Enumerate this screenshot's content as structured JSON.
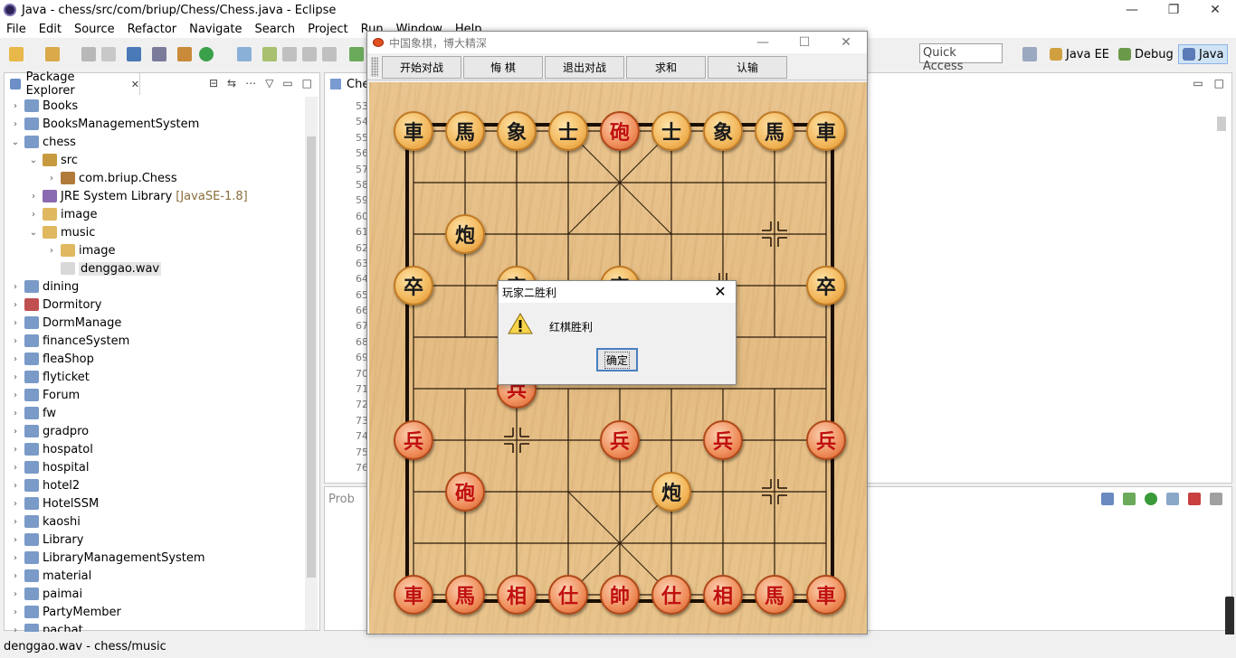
{
  "window": {
    "title": "Java - chess/src/com/briup/Chess/Chess.java - Eclipse",
    "min": "—",
    "restore": "❐",
    "close": "✕"
  },
  "menu": [
    "File",
    "Edit",
    "Source",
    "Refactor",
    "Navigate",
    "Search",
    "Project",
    "Run",
    "Window",
    "Help"
  ],
  "toolbar": {
    "quick_access": "Quick Access",
    "perspectives": [
      "Java EE",
      "Debug",
      "Java"
    ]
  },
  "package_explorer": {
    "tab_label": "Package Explorer",
    "tab_close": "✕",
    "items": [
      {
        "label": "Books",
        "arrow": "›",
        "icon": "project-icon",
        "indent": 0
      },
      {
        "label": "BooksManagementSystem",
        "arrow": "›",
        "icon": "project-icon",
        "indent": 0
      },
      {
        "label": "chess",
        "arrow": "⌄",
        "icon": "project-icon",
        "indent": 0
      },
      {
        "label": "src",
        "arrow": "⌄",
        "icon": "source-folder-icon",
        "indent": 1
      },
      {
        "label": "com.briup.Chess",
        "arrow": "›",
        "icon": "package-icon",
        "indent": 2
      },
      {
        "label": "JRE System Library",
        "decoration": "[JavaSE-1.8]",
        "arrow": "›",
        "icon": "library-icon",
        "indent": 1
      },
      {
        "label": "image",
        "arrow": "›",
        "icon": "folder-icon",
        "indent": 1
      },
      {
        "label": "music",
        "arrow": "⌄",
        "icon": "folder-icon",
        "indent": 1
      },
      {
        "label": "image",
        "arrow": "›",
        "icon": "folder-icon",
        "indent": 2
      },
      {
        "label": "denggao.wav",
        "arrow": "",
        "icon": "file-icon",
        "indent": 2,
        "selected": true
      },
      {
        "label": "dining",
        "arrow": "›",
        "icon": "project-icon",
        "indent": 0
      },
      {
        "label": "Dormitory",
        "arrow": "›",
        "icon": "project-error-icon",
        "indent": 0
      },
      {
        "label": "DormManage",
        "arrow": "›",
        "icon": "project-icon",
        "indent": 0
      },
      {
        "label": "financeSystem",
        "arrow": "›",
        "icon": "project-icon",
        "indent": 0
      },
      {
        "label": "fleaShop",
        "arrow": "›",
        "icon": "project-icon",
        "indent": 0
      },
      {
        "label": "flyticket",
        "arrow": "›",
        "icon": "project-icon",
        "indent": 0
      },
      {
        "label": "Forum",
        "arrow": "›",
        "icon": "project-icon",
        "indent": 0
      },
      {
        "label": "fw",
        "arrow": "›",
        "icon": "project-icon",
        "indent": 0
      },
      {
        "label": "gradpro",
        "arrow": "›",
        "icon": "project-icon",
        "indent": 0
      },
      {
        "label": "hospatol",
        "arrow": "›",
        "icon": "project-icon",
        "indent": 0
      },
      {
        "label": "hospital",
        "arrow": "›",
        "icon": "project-icon",
        "indent": 0
      },
      {
        "label": "hotel2",
        "arrow": "›",
        "icon": "project-icon",
        "indent": 0
      },
      {
        "label": "HotelSSM",
        "arrow": "›",
        "icon": "project-icon",
        "indent": 0
      },
      {
        "label": "kaoshi",
        "arrow": "›",
        "icon": "project-icon",
        "indent": 0
      },
      {
        "label": "Library",
        "arrow": "›",
        "icon": "project-icon",
        "indent": 0
      },
      {
        "label": "LibraryManagementSystem",
        "arrow": "›",
        "icon": "project-icon",
        "indent": 0
      },
      {
        "label": "material",
        "arrow": "›",
        "icon": "project-icon",
        "indent": 0
      },
      {
        "label": "paimai",
        "arrow": "›",
        "icon": "project-icon",
        "indent": 0
      },
      {
        "label": "PartyMember",
        "arrow": "›",
        "icon": "project-icon",
        "indent": 0
      },
      {
        "label": "pachat",
        "arrow": "›",
        "icon": "project-icon",
        "indent": 0
      }
    ]
  },
  "editor": {
    "tab_label": "Che",
    "line_numbers": [
      "53",
      "54",
      "55",
      "56",
      "57",
      "58",
      "59",
      "60",
      "61",
      "62",
      "63",
      "64",
      "65",
      "66",
      "67",
      "68",
      "69",
      "70",
      "71",
      "72",
      "73",
      "74",
      "75",
      "76"
    ]
  },
  "bottom_panel": {
    "tab_label": "Prob"
  },
  "status": {
    "text": "denggao.wav - chess/music"
  },
  "chess": {
    "title": "中国象棋，博大精深",
    "buttons": [
      "开始对战",
      "悔  棋",
      "退出对战",
      "求和",
      "认输"
    ],
    "pieces": [
      {
        "char": "車",
        "side": "black",
        "col": 0,
        "row": 0
      },
      {
        "char": "馬",
        "side": "black",
        "col": 1,
        "row": 0
      },
      {
        "char": "象",
        "side": "black",
        "col": 2,
        "row": 0
      },
      {
        "char": "士",
        "side": "black",
        "col": 3,
        "row": 0
      },
      {
        "char": "砲",
        "side": "red",
        "col": 4,
        "row": 0
      },
      {
        "char": "士",
        "side": "black",
        "col": 5,
        "row": 0
      },
      {
        "char": "象",
        "side": "black",
        "col": 6,
        "row": 0
      },
      {
        "char": "馬",
        "side": "black",
        "col": 7,
        "row": 0
      },
      {
        "char": "車",
        "side": "black",
        "col": 8,
        "row": 0
      },
      {
        "char": "炮",
        "side": "black",
        "col": 1,
        "row": 2
      },
      {
        "char": "卒",
        "side": "black",
        "col": 0,
        "row": 3
      },
      {
        "char": "卒",
        "side": "black",
        "col": 2,
        "row": 3
      },
      {
        "char": "卒",
        "side": "black",
        "col": 4,
        "row": 3
      },
      {
        "char": "卒",
        "side": "black",
        "col": 8,
        "row": 3
      },
      {
        "char": "兵",
        "side": "red",
        "col": 2,
        "row": 5
      },
      {
        "char": "兵",
        "side": "red",
        "col": 0,
        "row": 6
      },
      {
        "char": "兵",
        "side": "red",
        "col": 4,
        "row": 6
      },
      {
        "char": "兵",
        "side": "red",
        "col": 6,
        "row": 6
      },
      {
        "char": "兵",
        "side": "red",
        "col": 8,
        "row": 6
      },
      {
        "char": "砲",
        "side": "red",
        "col": 1,
        "row": 7
      },
      {
        "char": "炮",
        "side": "black",
        "col": 5,
        "row": 7
      },
      {
        "char": "車",
        "side": "red",
        "col": 0,
        "row": 9
      },
      {
        "char": "馬",
        "side": "red",
        "col": 1,
        "row": 9
      },
      {
        "char": "相",
        "side": "red",
        "col": 2,
        "row": 9
      },
      {
        "char": "仕",
        "side": "red",
        "col": 3,
        "row": 9
      },
      {
        "char": "帥",
        "side": "red",
        "col": 4,
        "row": 9
      },
      {
        "char": "仕",
        "side": "red",
        "col": 5,
        "row": 9
      },
      {
        "char": "相",
        "side": "red",
        "col": 6,
        "row": 9
      },
      {
        "char": "馬",
        "side": "red",
        "col": 7,
        "row": 9
      },
      {
        "char": "車",
        "side": "red",
        "col": 8,
        "row": 9
      }
    ]
  },
  "dialog": {
    "title": "玩家二胜利",
    "message": "红棋胜利",
    "ok_label": "确定",
    "close": "✕"
  }
}
